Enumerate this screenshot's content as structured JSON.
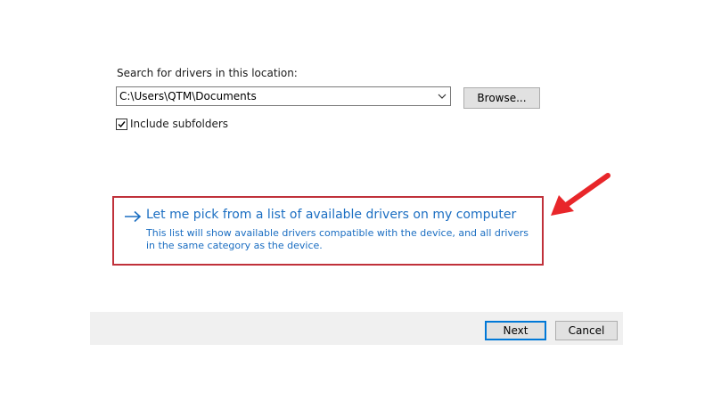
{
  "search": {
    "label": "Search for drivers in this location:",
    "path_value": "C:\\Users\\QTM\\Documents",
    "dropdown_icon": "chevron-down-icon",
    "browse_label": "Browse..."
  },
  "subfolders": {
    "label": "Include subfolders",
    "checked": true
  },
  "pick_option": {
    "icon": "arrow-right-icon",
    "title": "Let me pick from a list of available drivers on my computer",
    "description": "This list will show available drivers compatible with the device, and all drivers in the same category as the device.",
    "highlight_color": "#c0313a",
    "link_color": "#1b6ec2"
  },
  "annotation": {
    "icon": "red-pointer-arrow-icon",
    "color": "#e8262a"
  },
  "footer": {
    "next_label": "Next",
    "cancel_label": "Cancel"
  }
}
